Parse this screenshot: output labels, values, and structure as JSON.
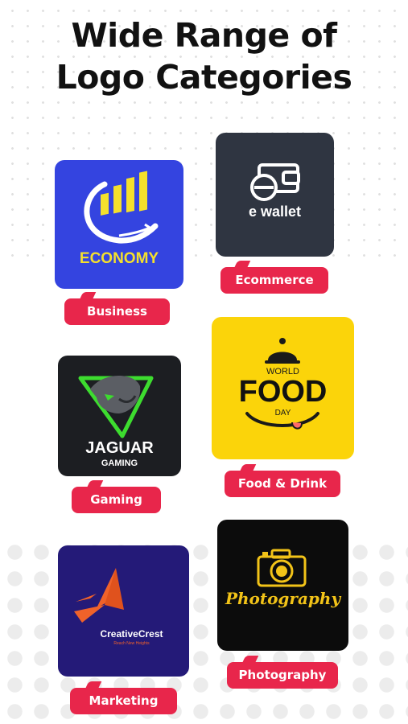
{
  "headline": {
    "line1": "Wide Range of",
    "line2": "Logo Categories"
  },
  "cards": [
    {
      "id": "economy",
      "logo_text": "ECONOMY",
      "tag": "Business",
      "bg": "#3444e0",
      "accent": "#f4e02c"
    },
    {
      "id": "ewallet",
      "logo_text": "e wallet",
      "tag": "Ecommerce",
      "bg": "#2f3541"
    },
    {
      "id": "jaguar",
      "logo_title": "JAGUAR",
      "logo_sub": "GAMING",
      "tag": "Gaming",
      "bg": "#1c1e22",
      "accent": "#3ddc2f"
    },
    {
      "id": "food",
      "logo_top": "WORLD",
      "logo_main": "FOOD",
      "logo_sub": "DAY",
      "tag": "Food & Drink",
      "bg": "#fbd40a"
    },
    {
      "id": "creative",
      "logo_text": "CreativeCrest",
      "logo_sub": "Reach New Heights",
      "tag": "Marketing",
      "bg": "#241a78",
      "accent": "#f0622a"
    },
    {
      "id": "photo",
      "logo_text": "Photography",
      "tag": "Photography",
      "bg": "#0c0c0c",
      "accent": "#f2c318"
    }
  ],
  "colors": {
    "tag_bg": "#e8264b",
    "tag_text": "#ffffff",
    "headline": "#111111"
  }
}
